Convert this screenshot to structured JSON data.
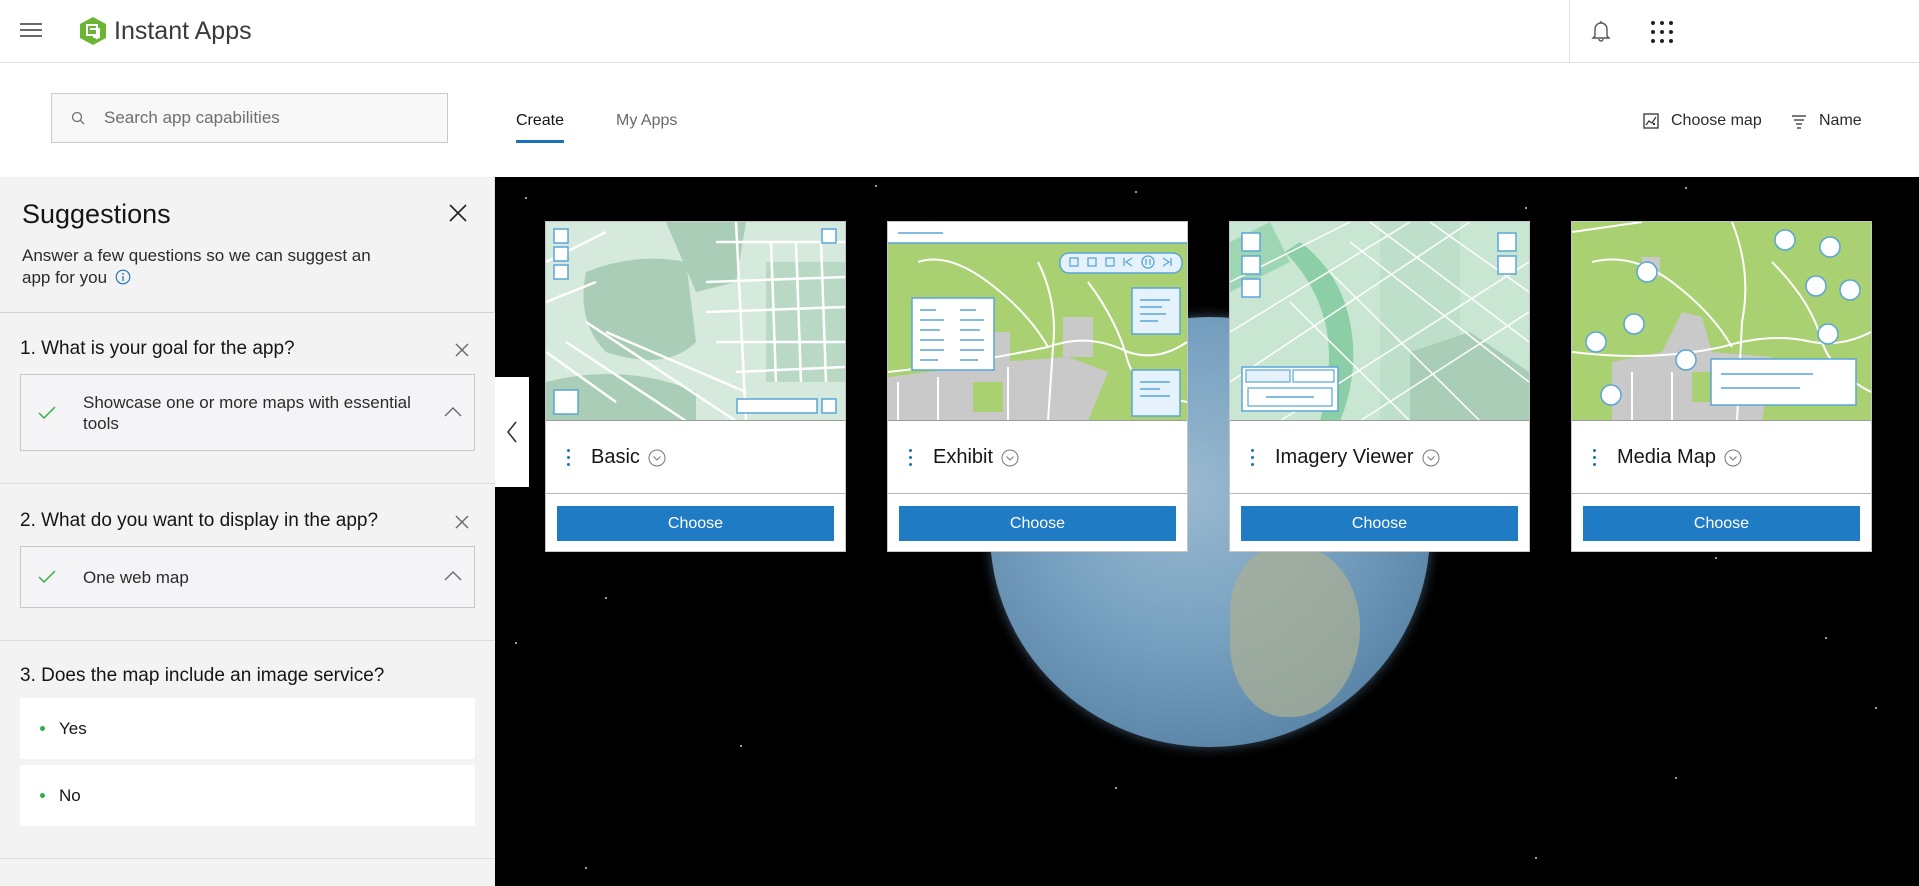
{
  "header": {
    "app_title": "Instant Apps",
    "logo_color": "#6cb433",
    "icons": [
      "menu-icon",
      "instant-apps-logo",
      "bell-icon",
      "app-launcher-icon"
    ]
  },
  "toolbar": {
    "search_placeholder": "Search app capabilities",
    "search_value": "",
    "tabs": [
      {
        "label": "Create",
        "active": true
      },
      {
        "label": "My Apps",
        "active": false
      }
    ],
    "choose_map_label": "Choose map",
    "sort_label": "Name",
    "accent_color": "#1c73b8"
  },
  "suggestions": {
    "title": "Suggestions",
    "description": "Answer a few questions so we can suggest an app for you",
    "questions": [
      {
        "title": "1. What is your goal for the app?",
        "selected_answer": "Showcase one or more maps with essential tools"
      },
      {
        "title": "2. What do you want to display in the app?",
        "selected_answer": "One web map"
      },
      {
        "title": "3. Does the map include an image service?",
        "options": [
          "Yes",
          "No"
        ]
      }
    ]
  },
  "cards": [
    {
      "title": "Basic",
      "button": "Choose"
    },
    {
      "title": "Exhibit",
      "button": "Choose"
    },
    {
      "title": "Imagery Viewer",
      "button": "Choose"
    },
    {
      "title": "Media Map",
      "button": "Choose"
    }
  ],
  "colors": {
    "primary_button": "#1f7bc3",
    "check_green": "#35ac46",
    "map_green_light": "#a9d071",
    "map_mint": "#b5d6c1"
  }
}
